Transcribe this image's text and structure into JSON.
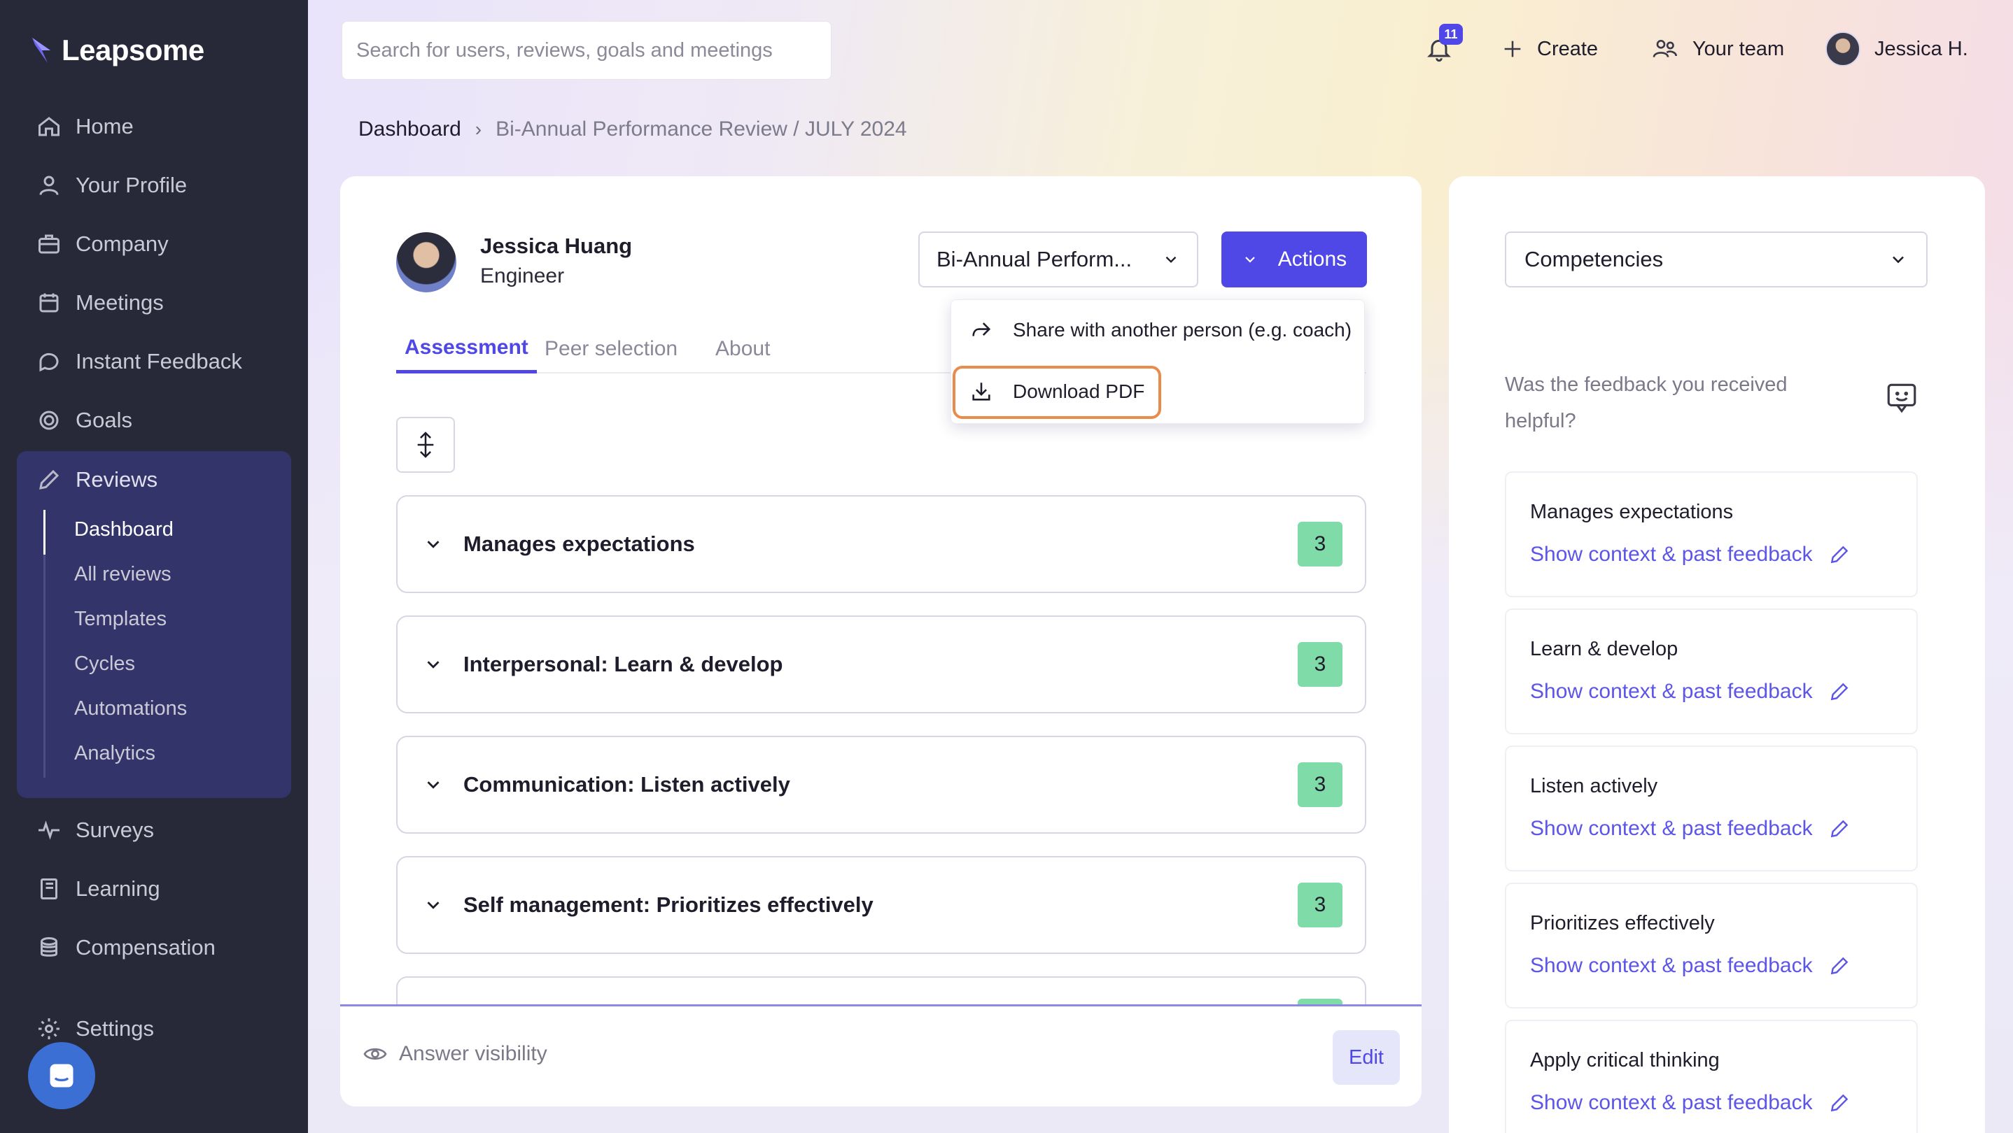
{
  "app": {
    "brand": "Leapsome"
  },
  "sidebar": {
    "items": [
      {
        "label": "Home",
        "icon": "home-icon"
      },
      {
        "label": "Your Profile",
        "icon": "user-icon"
      },
      {
        "label": "Company",
        "icon": "briefcase-icon"
      },
      {
        "label": "Meetings",
        "icon": "calendar-icon"
      },
      {
        "label": "Instant Feedback",
        "icon": "chat-icon"
      },
      {
        "label": "Goals",
        "icon": "target-icon"
      },
      {
        "label": "Reviews",
        "icon": "pencil-icon"
      },
      {
        "label": "Surveys",
        "icon": "pulse-icon"
      },
      {
        "label": "Learning",
        "icon": "book-icon"
      },
      {
        "label": "Compensation",
        "icon": "coins-icon"
      },
      {
        "label": "Settings",
        "icon": "gear-icon"
      }
    ],
    "reviews_sub": [
      "Dashboard",
      "All reviews",
      "Templates",
      "Cycles",
      "Automations",
      "Analytics"
    ],
    "active_sub": "Dashboard"
  },
  "header": {
    "search_placeholder": "Search for users, reviews, goals and meetings",
    "notifications_count": "11",
    "create_label": "Create",
    "team_label": "Your team",
    "user_label": "Jessica H."
  },
  "breadcrumb": {
    "root": "Dashboard",
    "current": "Bi-Annual Performance Review / JULY 2024"
  },
  "profile": {
    "name": "Jessica Huang",
    "role": "Engineer"
  },
  "review_select": {
    "value": "Bi-Annual Perform..."
  },
  "actions": {
    "label": "Actions",
    "menu": [
      "Share with another person (e.g. coach)",
      "Download PDF"
    ]
  },
  "tabs": [
    "Assessment",
    "Peer selection",
    "About"
  ],
  "competencies": [
    {
      "title": "Manages expectations",
      "score": "3"
    },
    {
      "title": "Interpersonal: Learn & develop",
      "score": "3"
    },
    {
      "title": "Communication: Listen actively",
      "score": "3"
    },
    {
      "title": "Self management: Prioritizes effectively",
      "score": "3"
    }
  ],
  "footer": {
    "visibility_label": "Answer visibility",
    "edit_label": "Edit"
  },
  "right_panel": {
    "select_value": "Competencies",
    "question": "Was the feedback you received helpful?",
    "link_label": "Show context & past feedback",
    "cards": [
      "Manages expectations",
      "Learn & develop",
      "Listen actively",
      "Prioritizes effectively",
      "Apply critical thinking"
    ]
  },
  "colors": {
    "accent": "#4f47e6",
    "sidebar": "#272838",
    "score": "#7fdca8",
    "highlight": "#e98b4a"
  }
}
